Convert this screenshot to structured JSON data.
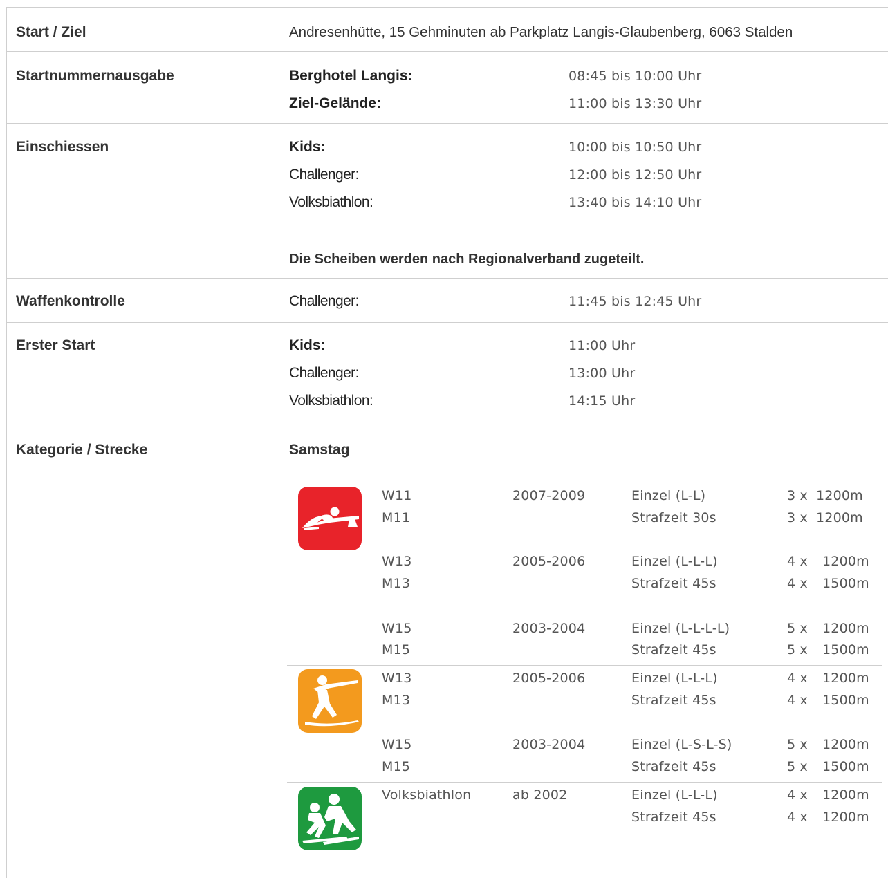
{
  "rows": {
    "start_ziel": {
      "label": "Start / Ziel",
      "value": "Andresenhütte, 15 Gehminuten ab Parkplatz Langis-Glaubenberg, 6063 Stalden"
    },
    "startnummern": {
      "label": "Startnummernausgabe",
      "items": [
        {
          "name": "Berghotel Langis:",
          "time": "08:45 bis 10:00 Uhr"
        },
        {
          "name": "Ziel-Gelände:",
          "time": "11:00 bis 13:30 Uhr"
        }
      ]
    },
    "einschiessen": {
      "label": "Einschiessen",
      "items": [
        {
          "name": "Kids:",
          "time": "10:00 bis 10:50 Uhr"
        },
        {
          "name": "Challenger:",
          "time": "12:00 bis 12:50 Uhr"
        },
        {
          "name": "Volksbiathlon:",
          "time": "13:40 bis 14:10 Uhr"
        }
      ],
      "note": "Die Scheiben werden nach Regionalverband zugeteilt."
    },
    "waffenkontrolle": {
      "label": "Waffenkontrolle",
      "items": [
        {
          "name": "Challenger:",
          "time": "11:45 bis 12:45 Uhr"
        }
      ]
    },
    "erster_start": {
      "label": "Erster Start",
      "items": [
        {
          "name": "Kids:",
          "time": "11:00 Uhr"
        },
        {
          "name": "Challenger:",
          "time": "13:00 Uhr"
        },
        {
          "name": "Volksbiathlon:",
          "time": "14:15 Uhr"
        }
      ]
    },
    "kategorie": {
      "label": "Kategorie / Strecke",
      "day": "Samstag",
      "groups": [
        {
          "icon": "prone-shooter-icon",
          "color": "#e8232a",
          "lines": [
            {
              "cat": "W11",
              "year": "2007-2009",
              "mode": "Einzel (L-L)",
              "laps": "3 x",
              "dist": "1200m"
            },
            {
              "cat": "M11",
              "year": "",
              "mode": "Strafzeit 30s",
              "laps": "3 x",
              "dist": "1200m"
            },
            {
              "cat": "W13",
              "year": "2005-2006",
              "mode": "Einzel (L-L-L)",
              "laps": "4 x",
              "dist": "1200m"
            },
            {
              "cat": "M13",
              "year": "",
              "mode": "Strafzeit 45s",
              "laps": "4 x",
              "dist": "1500m"
            },
            {
              "cat": "W15",
              "year": "2003-2004",
              "mode": "Einzel (L-L-L-L)",
              "laps": "5 x",
              "dist": "1200m"
            },
            {
              "cat": "M15",
              "year": "",
              "mode": "Strafzeit 45s",
              "laps": "5 x",
              "dist": "1500m"
            }
          ]
        },
        {
          "icon": "biathlete-shooting-icon",
          "color": "#f39a1e",
          "lines": [
            {
              "cat": "W13",
              "year": "2005-2006",
              "mode": "Einzel (L-L-L)",
              "laps": "4 x",
              "dist": "1200m"
            },
            {
              "cat": "M13",
              "year": "",
              "mode": "Strafzeit 45s",
              "laps": "4 x",
              "dist": "1500m"
            },
            {
              "cat": "W15",
              "year": "2003-2004",
              "mode": "Einzel (L-S-L-S)",
              "laps": "5 x",
              "dist": "1200m"
            },
            {
              "cat": "M15",
              "year": "",
              "mode": "Strafzeit 45s",
              "laps": "5 x",
              "dist": "1500m"
            }
          ]
        },
        {
          "icon": "cross-country-skiers-icon",
          "color": "#1e9a3f",
          "lines": [
            {
              "cat": "Volksbiathlon",
              "year": "ab 2002",
              "mode": "Einzel (L-L-L)",
              "laps": "4 x",
              "dist": "1200m"
            },
            {
              "cat": "",
              "year": "",
              "mode": "Strafzeit 45s",
              "laps": "4 x",
              "dist": "1200m"
            }
          ]
        }
      ]
    }
  }
}
